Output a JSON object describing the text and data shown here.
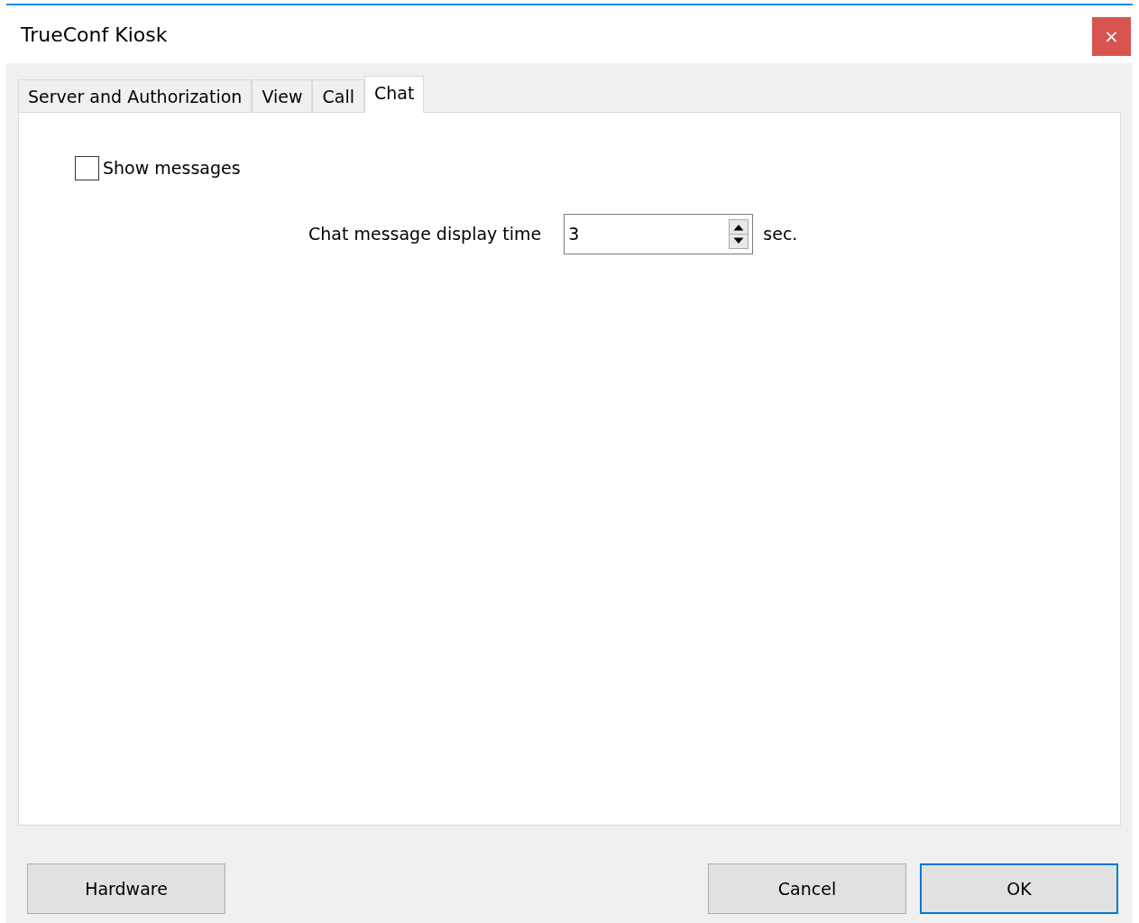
{
  "window": {
    "title": "TrueConf Kiosk",
    "close": "×"
  },
  "tabs": [
    {
      "label": "Server and Authorization",
      "selected": false
    },
    {
      "label": "View",
      "selected": false
    },
    {
      "label": "Call",
      "selected": false
    },
    {
      "label": "Chat",
      "selected": true
    }
  ],
  "show_messages": {
    "label": "Show messages",
    "checked": false
  },
  "display_time": {
    "label": "Chat message display time",
    "value": "3",
    "unit": "sec."
  },
  "buttons": [
    {
      "label": "Hardware",
      "kind": "left",
      "default": false
    },
    {
      "label": "Cancel",
      "kind": "right",
      "default": false
    },
    {
      "label": "OK",
      "kind": "right",
      "default": true
    }
  ]
}
